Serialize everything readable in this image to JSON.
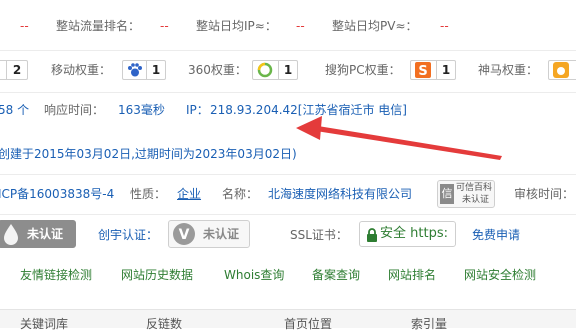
{
  "row1": {
    "v1": "--",
    "rank_label": "整站流量排名：",
    "v2": "--",
    "ip_label": "整站日均IP≈：",
    "v3": "--",
    "pv_label": "整站日均PV≈：",
    "v4": "--"
  },
  "row2": {
    "baidu_value": "2",
    "mobile_label": "移动权重：",
    "mobile_value": "1",
    "s360_label": "360权重：",
    "s360_value": "1",
    "sogou_label": "搜狗PC权重：",
    "sogou_value": "1",
    "shenma_label": "神马权重：",
    "colors": {
      "baidu_blue": "#2f64c8",
      "sogou_orange": "#f26f21",
      "shenma_orange": "#f5a623",
      "s360_green": "#6ab64a"
    }
  },
  "row3": {
    "count_text": "58 个",
    "response_label": "响应时间：",
    "response_value": "163毫秒",
    "ip_label": "IP：",
    "ip_value": "218.93.204.42[江苏省宿迁市 电信]"
  },
  "row4": {
    "text": "创建于2015年03月02日,过期时间为2023年03月02日)"
  },
  "row5": {
    "icp_value": "ICP备16003838号-4",
    "nature_label": "性质：",
    "nature_value": "企业",
    "name_label": "名称：",
    "name_value": "北海速度网络科技有限公司",
    "badge_line1": "可信百科",
    "badge_line2": "未认证",
    "review_label": "审核时间："
  },
  "row6": {
    "badge1_text": "未认证",
    "creative_label": "创宇认证：",
    "badge2_text": "未认证",
    "ssl_label": "SSL证书：",
    "ssl_button": "安全 https:",
    "free_apply": "免费申请"
  },
  "links": [
    "友情链接检测",
    "网站历史数据",
    "Whois查询",
    "备案查询",
    "网站排名",
    "网站安全检测"
  ],
  "table_head": [
    "关键词库",
    "反链数",
    "首页位置",
    "索引量"
  ],
  "annotation_color": "#e43b3b"
}
